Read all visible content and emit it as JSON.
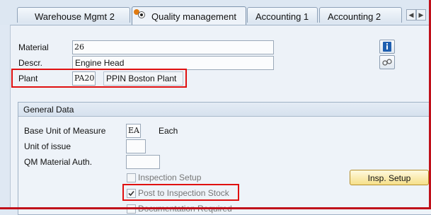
{
  "tabs": [
    {
      "label": "Warehouse Mgmt 2",
      "active": false
    },
    {
      "label": "Quality management",
      "active": true
    },
    {
      "label": "Accounting 1",
      "active": false
    },
    {
      "label": "Accounting 2",
      "active": false
    }
  ],
  "header": {
    "material_label": "Material",
    "material_value": "26",
    "descr_label": "Descr.",
    "descr_value": "Engine Head",
    "plant_label": "Plant",
    "plant_value": "PA20",
    "plant_name": "PPIN Boston Plant"
  },
  "general_data": {
    "title": "General Data",
    "base_uom_label": "Base Unit of Measure",
    "base_uom_value": "EA",
    "base_uom_text": "Each",
    "unit_of_issue_label": "Unit of issue",
    "unit_of_issue_value": "",
    "qm_auth_label": "QM Material Auth.",
    "qm_auth_value": "",
    "inspection_setup_label": "Inspection Setup",
    "inspection_setup_checked": false,
    "post_to_insp_label": "Post to Inspection Stock",
    "post_to_insp_checked": true,
    "doc_required_label": "Documentation Required",
    "doc_required_checked": false,
    "insp_setup_button": "Insp. Setup"
  },
  "colors": {
    "highlight": "#e01010",
    "frame": "#c0101a",
    "info_icon": "#1f5fb0",
    "button_face": "#f6df8a"
  },
  "icons": {
    "info": "info-icon",
    "glasses": "display-glasses-icon",
    "scroll_left": "scroll-left-icon",
    "scroll_right": "scroll-right-icon",
    "tab_list": "tab-list-icon"
  }
}
